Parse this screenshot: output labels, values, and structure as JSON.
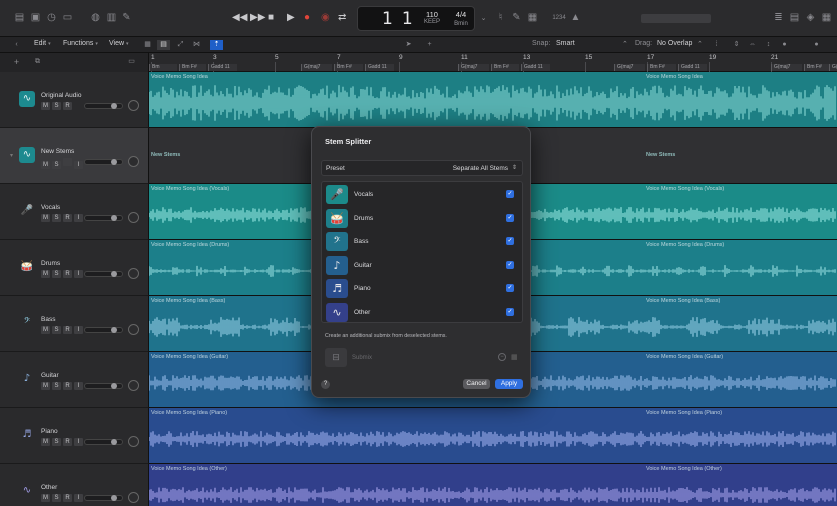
{
  "transport": {
    "lcd_bar": "1",
    "lcd_beat": "1",
    "tempo_value": "110",
    "tempo_label": "KEEP",
    "signature": "4/4",
    "key": "Bmin",
    "count_in": "1234"
  },
  "toolbar": {
    "edit": "Edit",
    "functions": "Functions",
    "view": "View",
    "snap_label": "Snap:",
    "snap_value": "Smart",
    "drag_label": "Drag:",
    "drag_value": "No Overlap"
  },
  "ruler": {
    "numbers": [
      "1",
      "3",
      "5",
      "7",
      "9",
      "11",
      "13",
      "15",
      "17",
      "19",
      "21"
    ],
    "chords": [
      "Bm",
      "Bm F#",
      "Gadd 11",
      "G(maj7",
      "Bm F#",
      "Gadd 11",
      "G(maj7",
      "Bm F#",
      "Gadd 11",
      "G(maj7",
      "Bm F#",
      "Gadd 11",
      "G(maj7",
      "Bm F#",
      "Gadd 11",
      "G(maj7"
    ]
  },
  "tracks": [
    {
      "name": "Original Audio",
      "region": "Voice Memo Song Idea",
      "region2": "Voice Memo Song Idea",
      "icon": "waveform-icon",
      "buttons": [
        "M",
        "S",
        "R"
      ]
    },
    {
      "name": "New Stems",
      "region": "New Stems",
      "region2": "New Stems",
      "icon": "waveform-icon",
      "buttons": [
        "M",
        "S",
        "",
        "I"
      ]
    },
    {
      "name": "Vocals",
      "region": "Voice Memo Song Idea (Vocals)",
      "region2": "Voice Memo Song Idea (Vocals)",
      "icon": "microphone-icon",
      "buttons": [
        "M",
        "S",
        "R",
        "I"
      ]
    },
    {
      "name": "Drums",
      "region": "Voice Memo Song Idea (Drums)",
      "region2": "Voice Memo Song Idea (Drums)",
      "icon": "drums-icon",
      "buttons": [
        "M",
        "S",
        "R",
        "I"
      ]
    },
    {
      "name": "Bass",
      "region": "Voice Memo Song Idea (Bass)",
      "region2": "Voice Memo Song Idea (Bass)",
      "icon": "bass-guitar-icon",
      "buttons": [
        "M",
        "S",
        "R",
        "I"
      ]
    },
    {
      "name": "Guitar",
      "region": "Voice Memo Song Idea (Guitar)",
      "region2": "Voice Memo Song Idea (Guitar)",
      "icon": "guitar-icon",
      "buttons": [
        "M",
        "S",
        "R",
        "I"
      ]
    },
    {
      "name": "Piano",
      "region": "Voice Memo Song Idea (Piano)",
      "region2": "Voice Memo Song Idea (Piano)",
      "icon": "piano-icon",
      "buttons": [
        "M",
        "S",
        "R",
        "I"
      ]
    },
    {
      "name": "Other",
      "region": "Voice Memo Song Idea (Other)",
      "region2": "Voice Memo Song Idea (Other)",
      "icon": "waveform-icon",
      "buttons": [
        "M",
        "S",
        "R",
        "I"
      ]
    }
  ],
  "dialog": {
    "title": "Stem Splitter",
    "preset_label": "Preset",
    "preset_value": "Separate All Stems",
    "stems": [
      {
        "label": "Vocals",
        "icon": "microphone-icon",
        "checked": true
      },
      {
        "label": "Drums",
        "icon": "drums-icon",
        "checked": true
      },
      {
        "label": "Bass",
        "icon": "bass-guitar-icon",
        "checked": true
      },
      {
        "label": "Guitar",
        "icon": "guitar-icon",
        "checked": true
      },
      {
        "label": "Piano",
        "icon": "piano-icon",
        "checked": true
      },
      {
        "label": "Other",
        "icon": "waveform-icon",
        "checked": true
      }
    ],
    "hint": "Create an additional submix from deselected stems.",
    "submix_label": "Submix",
    "help": "?",
    "cancel": "Cancel",
    "apply": "Apply"
  },
  "colors": {
    "accent": "#2f6fe0",
    "teal": "#1d8a8f",
    "vocals": "#1c8a8a",
    "drums": "#1e7f8a",
    "bass": "#21738c",
    "guitar": "#245f8e",
    "piano": "#2a4d8e",
    "other": "#34408a"
  }
}
